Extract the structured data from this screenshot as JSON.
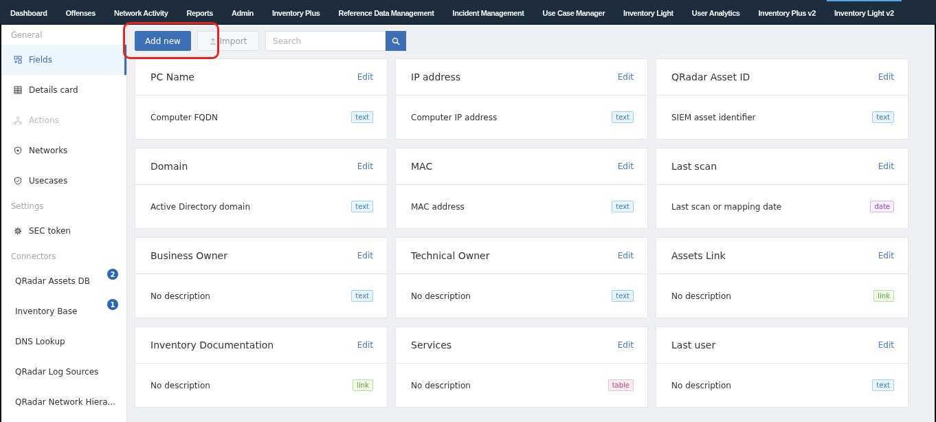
{
  "nav": {
    "tabs": [
      {
        "label": "Dashboard",
        "selected": false
      },
      {
        "label": "Offenses",
        "selected": false
      },
      {
        "label": "Network Activity",
        "selected": false
      },
      {
        "label": "Reports",
        "selected": false
      },
      {
        "label": "Admin",
        "selected": false
      },
      {
        "label": "Inventory Plus",
        "selected": false
      },
      {
        "label": "Reference Data Management",
        "selected": false
      },
      {
        "label": "Incident Management",
        "selected": false
      },
      {
        "label": "Use Case Manager",
        "selected": false
      },
      {
        "label": "Inventory Light",
        "selected": false
      },
      {
        "label": "User Analytics",
        "selected": false
      },
      {
        "label": "Inventory Plus v2",
        "selected": false
      },
      {
        "label": "Inventory Light v2",
        "selected": true
      }
    ]
  },
  "sidebar": {
    "sections": [
      {
        "heading": "General",
        "items": [
          {
            "label": "Fields",
            "kind": "icon",
            "selected": true,
            "disabled": false
          },
          {
            "label": "Details card",
            "kind": "icon",
            "selected": false,
            "disabled": false
          },
          {
            "label": "Actions",
            "kind": "icon",
            "selected": false,
            "disabled": true
          },
          {
            "label": "Networks",
            "kind": "icon",
            "selected": false,
            "disabled": false
          },
          {
            "label": "Usecases",
            "kind": "icon",
            "selected": false,
            "disabled": false
          }
        ]
      },
      {
        "heading": "Settings",
        "items": [
          {
            "label": "SEC token",
            "kind": "icon",
            "selected": false,
            "disabled": false
          }
        ]
      },
      {
        "heading": "Connectors",
        "items": [
          {
            "label": "QRadar Assets DB",
            "badge": "2",
            "selected": false,
            "disabled": false
          },
          {
            "label": "Inventory Base",
            "badge": "1",
            "selected": false,
            "disabled": false
          },
          {
            "label": "DNS Lookup",
            "selected": false,
            "disabled": false
          },
          {
            "label": "QRadar Log Sources",
            "selected": false,
            "disabled": false
          },
          {
            "label": "QRadar Network Hiera...",
            "selected": false,
            "disabled": false
          }
        ]
      }
    ]
  },
  "toolbar": {
    "add_button": {
      "label": "Add new",
      "highlighted": true
    },
    "import_button": {
      "label": "Import",
      "disabled": true
    },
    "search": {
      "placeholder": "Search"
    }
  },
  "fields": [
    {
      "name": "PC Name",
      "action": "Edit",
      "description": "Computer FQDN",
      "type": "text"
    },
    {
      "name": "IP address",
      "action": "Edit",
      "description": "Computer IP address",
      "type": "text"
    },
    {
      "name": "QRadar Asset ID",
      "action": "Edit",
      "description": "SIEM asset identifier",
      "type": "text"
    },
    {
      "name": "Domain",
      "action": "Edit",
      "description": "Active Directory domain",
      "type": "text"
    },
    {
      "name": "MAC",
      "action": "Edit",
      "description": "MAC address",
      "type": "text"
    },
    {
      "name": "Last scan",
      "action": "Edit",
      "description": "Last scan or mapping date",
      "type": "date"
    },
    {
      "name": "Business Owner",
      "action": "Edit",
      "description": "No description",
      "type": "text"
    },
    {
      "name": "Technical Owner",
      "action": "Edit",
      "description": "No description",
      "type": "text"
    },
    {
      "name": "Assets Link",
      "action": "Edit",
      "description": "No description",
      "type": "link"
    },
    {
      "name": "Inventory Documentation",
      "action": "Edit",
      "description": "No description",
      "type": "link"
    },
    {
      "name": "Services",
      "action": "Edit",
      "description": "No description",
      "type": "table"
    },
    {
      "name": "Last user",
      "action": "Edit",
      "description": "No description",
      "type": "text"
    }
  ]
}
